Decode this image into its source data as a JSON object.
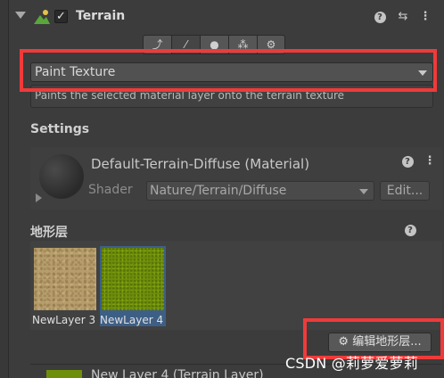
{
  "component": {
    "title": "Terrain",
    "enabled": true,
    "enabled_mark": "✓",
    "header_icons": [
      "terrain-icon",
      "help-icon",
      "preset-icon",
      "more-icon"
    ]
  },
  "toolbar": {
    "tools": [
      {
        "name": "raise-lower-icon",
        "glyph": "⤴"
      },
      {
        "name": "paint-brush-icon",
        "glyph": "⁄"
      },
      {
        "name": "tree-icon",
        "glyph": "●"
      },
      {
        "name": "details-icon",
        "glyph": "⁂"
      },
      {
        "name": "settings-icon",
        "glyph": "⚙"
      }
    ]
  },
  "paint": {
    "mode": "Paint Texture",
    "description": "Paints the selected material layer onto the terrain texture"
  },
  "settings": {
    "heading": "Settings",
    "material_name": "Default-Terrain-Diffuse (Material)",
    "shader_label": "Shader",
    "shader_value": "Nature/Terrain/Diffuse",
    "edit_label": "Edit..."
  },
  "layers": {
    "heading": "地形层",
    "items": [
      {
        "name": "NewLayer 3",
        "texture": "sand",
        "selected": false
      },
      {
        "name": "NewLayer 4",
        "texture": "grass",
        "selected": true
      }
    ],
    "edit_button": "编辑地形层..."
  },
  "selected_layer": {
    "label": "New Layer 4 (Terrain Layer)"
  },
  "annotation": {
    "highlight_color": "#f03a3a"
  },
  "watermark": "CSDN @莉萝爱萝莉"
}
